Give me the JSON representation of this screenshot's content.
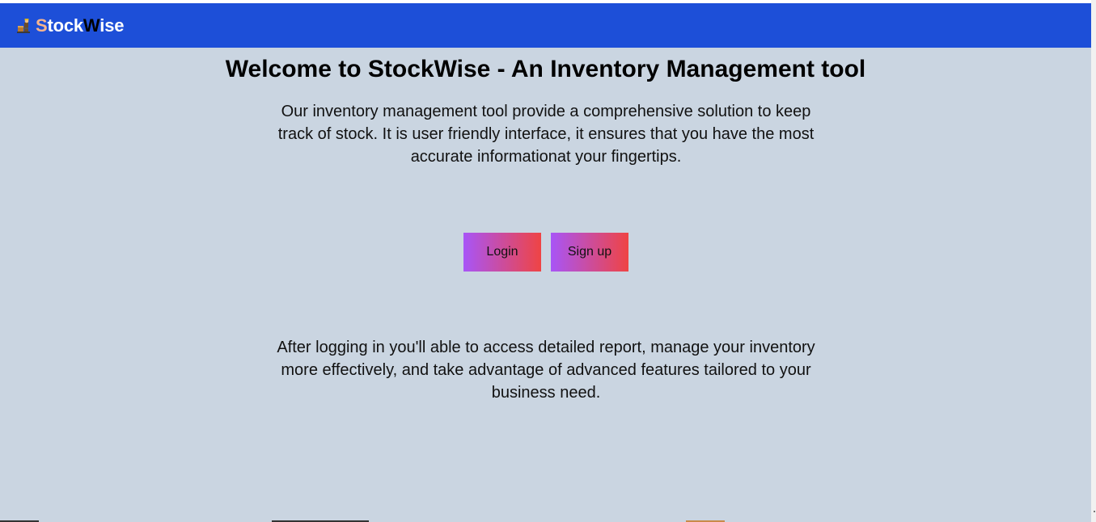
{
  "header": {
    "brand_parts": [
      "S",
      "tock",
      "W",
      "ise"
    ],
    "logo_icon": "warehouse-worker-icon"
  },
  "main": {
    "title": "Welcome to StockWise - An Inventory Management tool",
    "intro": "Our inventory management tool provide a comprehensive solution to keep track of stock. It is user friendly interface, it ensures that you have the most accurate informationat your fingertips.",
    "login_label": "Login",
    "signup_label": "Sign up",
    "outro": "After logging in you'll able to access detailed report, manage your inventory more effectively, and take advantage of advanced features tailored to your business need."
  },
  "colors": {
    "navbar": "#1d4fd8",
    "background": "#cad5e1",
    "brand_accent": "#f6b48e",
    "button_gradient_start": "#a855f7",
    "button_gradient_end": "#ef4444"
  }
}
